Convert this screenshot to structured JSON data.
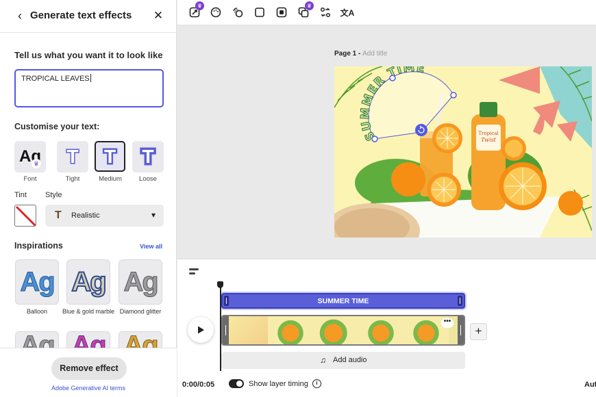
{
  "panel": {
    "title": "Generate text effects",
    "back_icon": "chevron-left-icon",
    "close_icon": "close-icon",
    "prompt_label": "Tell us what you want it to look like",
    "prompt_value": "TROPICAL LEAVES",
    "customise_label": "Customise your text:",
    "shape_options": [
      {
        "label": "Font",
        "glyph": "Ag"
      },
      {
        "label": "Tight",
        "glyph": "T"
      },
      {
        "label": "Medium",
        "glyph": "T",
        "selected": true
      },
      {
        "label": "Loose",
        "glyph": "T"
      }
    ],
    "tint_label": "Tint",
    "style_label": "Style",
    "style_value": "Realistic",
    "style_icon_glyph": "T",
    "inspirations_label": "Inspirations",
    "view_all": "View all",
    "inspirations": [
      {
        "label": "Balloon",
        "glyph": "Ag"
      },
      {
        "label": "Blue & gold marble",
        "glyph": "Ag"
      },
      {
        "label": "Diamond glitter",
        "glyph": "Ag"
      }
    ],
    "inspirations_row2_glyph": "Ag",
    "remove_effect": "Remove effect",
    "ai_terms": "Adobe Generative AI terms"
  },
  "toolbar": {
    "icons": [
      "magic-resize-icon",
      "palette-icon",
      "animation-icon",
      "shape-icon",
      "mask-icon",
      "layers-icon",
      "swap-icon",
      "translate-icon"
    ]
  },
  "canvas": {
    "page_label": "Page 1 -",
    "add_title": "Add title",
    "curved_text": "SUMMER TIME",
    "bottle_brand": "Tropical",
    "bottle_brand_script": "Twist"
  },
  "timeline": {
    "text_track_label": "SUMMER TIME",
    "more_glyph": "•••",
    "add_audio": "Add audio",
    "time_code": "0:00/0:05",
    "layer_timing": "Show layer timing",
    "info_glyph": "i",
    "auto_label": "Aut"
  },
  "colors": {
    "accent": "#5258e4",
    "premium": "#7b3fc9",
    "link": "#3a52d4"
  }
}
